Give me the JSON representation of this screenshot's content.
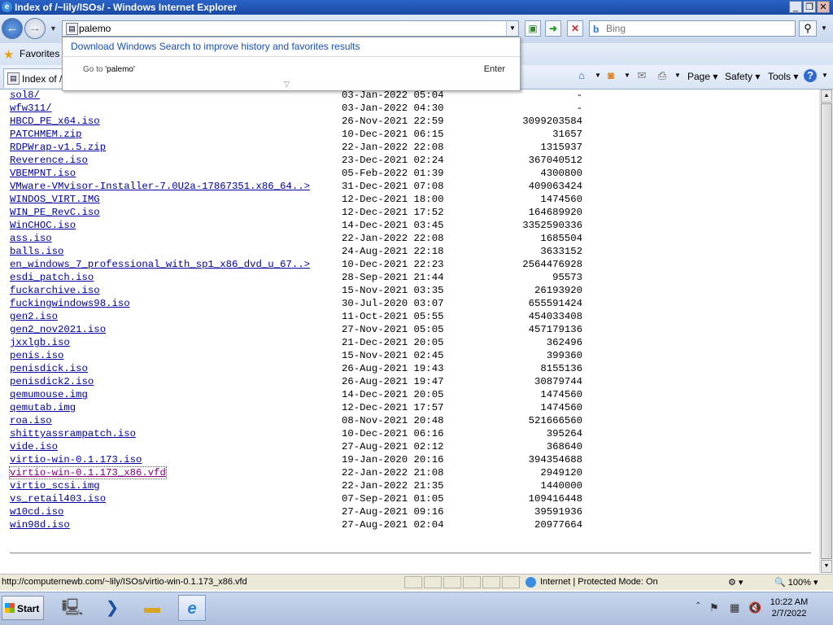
{
  "window": {
    "title": "Index of /~lily/ISOs/ - Windows Internet Explorer",
    "controls": {
      "minimize": "_",
      "restore": "❐",
      "close": "✕"
    }
  },
  "nav": {
    "address_value": "palemo",
    "search_placeholder": "Bing"
  },
  "autocomplete": {
    "download_link": "Download Windows Search to improve history and favorites results",
    "goto_prefix": "Go to ",
    "goto_value": "'palemo'",
    "enter_label": "Enter"
  },
  "favorites": {
    "label": "Favorites"
  },
  "tab": {
    "label": "Index of /"
  },
  "commands": {
    "page": "Page ▾",
    "safety": "Safety ▾",
    "tools": "Tools ▾"
  },
  "listing": [
    {
      "name": "sol8/",
      "date": "03-Jan-2022 05:04",
      "size": "-"
    },
    {
      "name": "wfw311/",
      "date": "03-Jan-2022 04:30",
      "size": "-"
    },
    {
      "name": "HBCD_PE_x64.iso",
      "date": "26-Nov-2021 22:59",
      "size": "3099203584"
    },
    {
      "name": "PATCHMEM.zip",
      "date": "10-Dec-2021 06:15",
      "size": "31657"
    },
    {
      "name": "RDPWrap-v1.5.zip",
      "date": "22-Jan-2022 22:08",
      "size": "1315937"
    },
    {
      "name": "Reverence.iso",
      "date": "23-Dec-2021 02:24",
      "size": "367040512"
    },
    {
      "name": "VBEMPNT.iso",
      "date": "05-Feb-2022 01:39",
      "size": "4300800"
    },
    {
      "name": "VMware-VMvisor-Installer-7.0U2a-17867351.x86_64..>",
      "date": "31-Dec-2021 07:08",
      "size": "409063424"
    },
    {
      "name": "WINDOS_VIRT.IMG",
      "date": "12-Dec-2021 18:00",
      "size": "1474560"
    },
    {
      "name": "WIN_PE_RevC.iso",
      "date": "12-Dec-2021 17:52",
      "size": "164689920"
    },
    {
      "name": "WinCHOC.iso",
      "date": "14-Dec-2021 03:45",
      "size": "3352590336"
    },
    {
      "name": "ass.iso",
      "date": "22-Jan-2022 22:08",
      "size": "1685504"
    },
    {
      "name": "balls.iso",
      "date": "24-Aug-2021 22:18",
      "size": "3633152"
    },
    {
      "name": "en_windows_7_professional_with_sp1_x86_dvd_u_67..>",
      "date": "10-Dec-2021 22:23",
      "size": "2564476928"
    },
    {
      "name": "esdi_patch.iso",
      "date": "28-Sep-2021 21:44",
      "size": "95573"
    },
    {
      "name": "fuckarchive.iso",
      "date": "15-Nov-2021 03:35",
      "size": "26193920"
    },
    {
      "name": "fuckingwindows98.iso",
      "date": "30-Jul-2020 03:07",
      "size": "655591424"
    },
    {
      "name": "gen2.iso",
      "date": "11-Oct-2021 05:55",
      "size": "454033408"
    },
    {
      "name": "gen2_nov2021.iso",
      "date": "27-Nov-2021 05:05",
      "size": "457179136"
    },
    {
      "name": "jxxlgb.iso",
      "date": "21-Dec-2021 20:05",
      "size": "362496"
    },
    {
      "name": "penis.iso",
      "date": "15-Nov-2021 02:45",
      "size": "399360"
    },
    {
      "name": "penisdick.iso",
      "date": "26-Aug-2021 19:43",
      "size": "8155136"
    },
    {
      "name": "penisdick2.iso",
      "date": "26-Aug-2021 19:47",
      "size": "30879744"
    },
    {
      "name": "qemumouse.img",
      "date": "14-Dec-2021 20:05",
      "size": "1474560"
    },
    {
      "name": "qemutab.img",
      "date": "12-Dec-2021 17:57",
      "size": "1474560"
    },
    {
      "name": "roa.iso",
      "date": "08-Nov-2021 20:48",
      "size": "521666560"
    },
    {
      "name": "shittyassrampatch.iso",
      "date": "10-Dec-2021 06:16",
      "size": "395264"
    },
    {
      "name": "vide.iso",
      "date": "27-Aug-2021 02:12",
      "size": "368640"
    },
    {
      "name": "virtio-win-0.1.173.iso",
      "date": "19-Jan-2020 20:16",
      "size": "394354688"
    },
    {
      "name": "virtio-win-0.1.173_x86.vfd",
      "date": "22-Jan-2022 21:08",
      "size": "2949120",
      "state": "hover"
    },
    {
      "name": "virtio_scsi.img",
      "date": "22-Jan-2022 21:35",
      "size": "1440000"
    },
    {
      "name": "vs_retail403.iso",
      "date": "07-Sep-2021 01:05",
      "size": "109416448"
    },
    {
      "name": "w10cd.iso",
      "date": "27-Aug-2021 09:16",
      "size": "39591936"
    },
    {
      "name": "win98d.iso",
      "date": "27-Aug-2021 02:04",
      "size": "20977664"
    }
  ],
  "statusbar": {
    "url": "http://computernewb.com/~lily/ISOs/virtio-win-0.1.173_x86.vfd",
    "zone": "Internet | Protected Mode: On",
    "zoom": "100%"
  },
  "taskbar": {
    "start_label": "Start",
    "time": "10:22 AM",
    "date": "2/7/2022"
  },
  "icons": [
    "ie-icon",
    "back-arrow-icon",
    "forward-arrow-icon",
    "page-icon",
    "compat-icon",
    "go-arrow-icon",
    "stop-icon",
    "bing-icon",
    "search-icon",
    "star-icon",
    "home-icon",
    "rss-icon",
    "mail-icon",
    "print-icon",
    "help-icon",
    "globe-icon",
    "windows-logo-icon",
    "server-manager-icon",
    "powershell-icon",
    "explorer-folder-icon",
    "flag-icon",
    "network-icon",
    "speaker-muted-icon"
  ],
  "colors": {
    "titlebar": "#1a4aa4",
    "link": "#0000a0",
    "visited": "#800080",
    "chrome": "#d6e2f3"
  }
}
